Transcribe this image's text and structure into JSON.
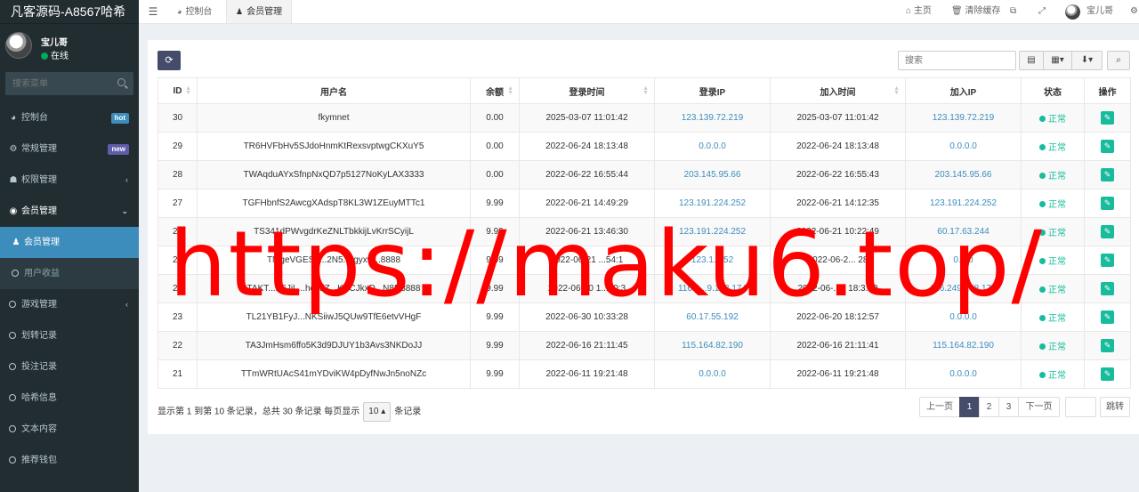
{
  "app": {
    "brand": "凡客源码-A8567哈希",
    "user_name": "宝儿哥",
    "user_status": "在线",
    "search_placeholder": "搜索菜单"
  },
  "sidebar": {
    "items": [
      {
        "label": "控制台",
        "icon": "dashboard-icon",
        "badge": "hot"
      },
      {
        "label": "常规管理",
        "icon": "cogs-icon",
        "badge": "new"
      },
      {
        "label": "权限管理",
        "icon": "users-icon",
        "chevron": "‹"
      },
      {
        "label": "会员管理",
        "icon": "user-circle-icon",
        "chevron": "⌄"
      },
      {
        "label": "会员管理",
        "icon": "user-icon"
      },
      {
        "label": "用户收益",
        "icon": "circle-icon"
      },
      {
        "label": "游戏管理",
        "icon": "circle-icon",
        "chevron": "‹"
      },
      {
        "label": "划转记录",
        "icon": "circle-icon"
      },
      {
        "label": "投注记录",
        "icon": "circle-icon"
      },
      {
        "label": "哈希信息",
        "icon": "circle-icon"
      },
      {
        "label": "文本内容",
        "icon": "circle-icon"
      },
      {
        "label": "推荐钱包",
        "icon": "circle-icon"
      }
    ]
  },
  "topbar": {
    "tabs": [
      {
        "label": "控制台",
        "icon": "dashboard-icon"
      },
      {
        "label": "会员管理",
        "icon": "user-icon"
      }
    ],
    "home": "主页",
    "clear_cache": "清除缓存",
    "user_name": "宝儿哥"
  },
  "toolbar": {
    "search_placeholder": "搜索"
  },
  "table": {
    "headers": [
      "ID",
      "用户名",
      "余额",
      "登录时间",
      "登录IP",
      "加入时间",
      "加入IP",
      "状态",
      "操作"
    ],
    "rows": [
      [
        "30",
        "fkymnet",
        "0.00",
        "2025-03-07 11:01:42",
        "123.139.72.219",
        "2025-03-07 11:01:42",
        "123.139.72.219",
        "正常"
      ],
      [
        "29",
        "TR6HVFbHv5SJdoHnmKtRexsvptwgCKXuY5",
        "0.00",
        "2022-06-24 18:13:48",
        "0.0.0.0",
        "2022-06-24 18:13:48",
        "0.0.0.0",
        "正常"
      ],
      [
        "28",
        "TWAqduAYxSfnpNxQD7p5127NoKyLAX3333",
        "0.00",
        "2022-06-22 16:55:44",
        "203.145.95.66",
        "2022-06-22 16:55:43",
        "203.145.95.66",
        "正常"
      ],
      [
        "27",
        "TGFHbnfS2AwcgXAdspT8KL3W1ZEuyMTTc1",
        "9.99",
        "2022-06-21 14:49:29",
        "123.191.224.252",
        "2022-06-21 14:12:35",
        "123.191.224.252",
        "正常"
      ],
      [
        "26",
        "TS341dPWvgdrKeZNLTbkkijLvKrrSCyijL",
        "9.99",
        "2022-06-21 13:46:30",
        "123.191.224.252",
        "2022-06-21 10:22:49",
        "60.17.63.244",
        "正常"
      ],
      [
        "25",
        "TMgeVGES3...2N5...rgyxw...8888",
        "9.99",
        "2022-06-21 ...54:1",
        "123.1..252",
        "2022-06-2... 28",
        "0.0.0",
        "正常"
      ],
      [
        "24",
        "TAKT...P6JiL...hesdZ...KVCJkxD...N8R8888",
        "9.99",
        "2022-06-20 1...30:3",
        "116.2...9.168.174",
        "2022-06-...0 18:3...9",
        "116.249.168.174",
        "正常"
      ],
      [
        "23",
        "TL21YB1FyJ...NKSiiwJ5QUw9TfE6etvVHgF",
        "9.99",
        "2022-06-30 10:33:28",
        "60.17.55.192",
        "2022-06-20 18:12:57",
        "0.0.0.0",
        "正常"
      ],
      [
        "22",
        "TA3JmHsm6ffo5K3d9DJUY1b3Avs3NKDoJJ",
        "9.99",
        "2022-06-16 21:11:45",
        "115.164.82.190",
        "2022-06-16 21:11:41",
        "115.164.82.190",
        "正常"
      ],
      [
        "21",
        "TTmWRtUAcS41mYDviKW4pDyfNwJn5noNZc",
        "9.99",
        "2022-06-11 19:21:48",
        "0.0.0.0",
        "2022-06-11 19:21:48",
        "0.0.0.0",
        "正常"
      ]
    ]
  },
  "footer": {
    "info_prefix": "显示第 1 到第 10 条记录，总共 30 条记录 每页显示",
    "page_size": "10",
    "info_suffix": "条记录",
    "prev": "上一页",
    "pages": [
      "1",
      "2",
      "3"
    ],
    "next": "下一页",
    "go": "跳转"
  },
  "watermark": "https://maku6.top/"
}
